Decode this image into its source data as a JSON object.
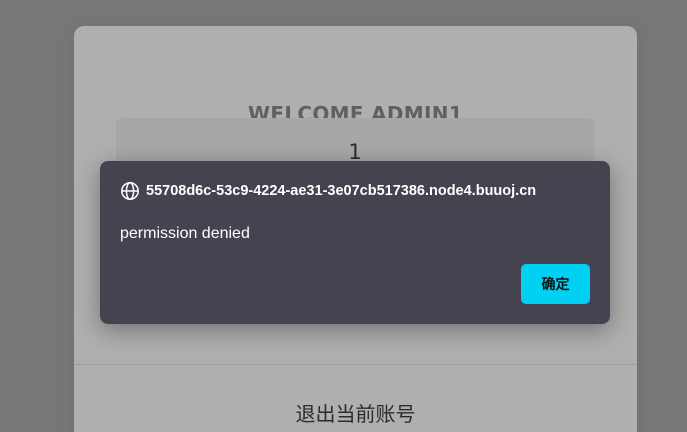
{
  "page": {
    "welcome_title": "WELCOME ADMIN1",
    "value": "1",
    "logout_label": "退出当前账号"
  },
  "dialog": {
    "origin": "55708d6c-53c9-4224-ae31-3e07cb517386.node4.buuoj.cn",
    "origin_icon": "globe-icon",
    "message": "permission denied",
    "ok_label": "确定"
  },
  "colors": {
    "dialog_background": "#454350",
    "ok_button": "#00d0f2",
    "overlay": "rgba(60,60,60,0.38)"
  }
}
